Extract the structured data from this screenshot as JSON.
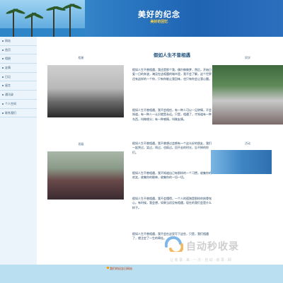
{
  "header": {
    "title": "美好的纪念",
    "subtitle": "美好的回忆"
  },
  "sidebar": {
    "items": [
      {
        "label": "网站"
      },
      {
        "label": "首页"
      },
      {
        "label": "相册"
      },
      {
        "label": "友情"
      },
      {
        "label": "日记"
      },
      {
        "label": "留言"
      },
      {
        "label": "通讯录"
      },
      {
        "label": "个人空间"
      },
      {
        "label": "联系我们"
      }
    ]
  },
  "left_column": {
    "caption_top": "相册",
    "caption_mid": "班级"
  },
  "right_column": {
    "caption_top": "同学",
    "caption_mid": "活动"
  },
  "article": {
    "title": "假如人生不曾相遇",
    "paragraphs": [
      "假如人生不曾相遇，我还是那个我，偶尔做做梦，然后，开始日复一日的奔波，淹没在这喧嚣的城市里，我不会了解，这个世界还有这样的一个你，只有你能让我回味，也只有你会让我心酸。",
      "假如人生不曾相遇，我不会相信，有一种人可以一见钟情，不会知道，有一种人一认识就是永远。只是，相遇了，才知道有一种东西，叫做缘分；有一种感情，叫做友情。",
      "假如人生不曾相遇，我不曾想过会拥有一个这么好的朋友，我们一起哭过，笑过，闹过，也疯过。回不去的时光，忘不掉的你们。",
      "假如人生不曾相遇，我不知道自己有那样的一个习惯，收集你的欢笑，收集你的眼神，收集你的一切一切。",
      "假如人生不曾相遇，我不会懂得，一个人的孤独是那样的刻骨铭心。有时候，我会想，如果当初没有相遇，现在的我们会是什么样子。",
      "假如人生不曾相遇，我不会在这里写下这些，只是，我们相遇了，就注定了一生的牵挂。"
    ]
  },
  "footer": {
    "link": "我们的纪念日网站"
  },
  "watermark": {
    "main": "自动秒收录",
    "sub": "让 收 录 · 来 · 一 次 · 自 动 · 收 录 · 网"
  }
}
